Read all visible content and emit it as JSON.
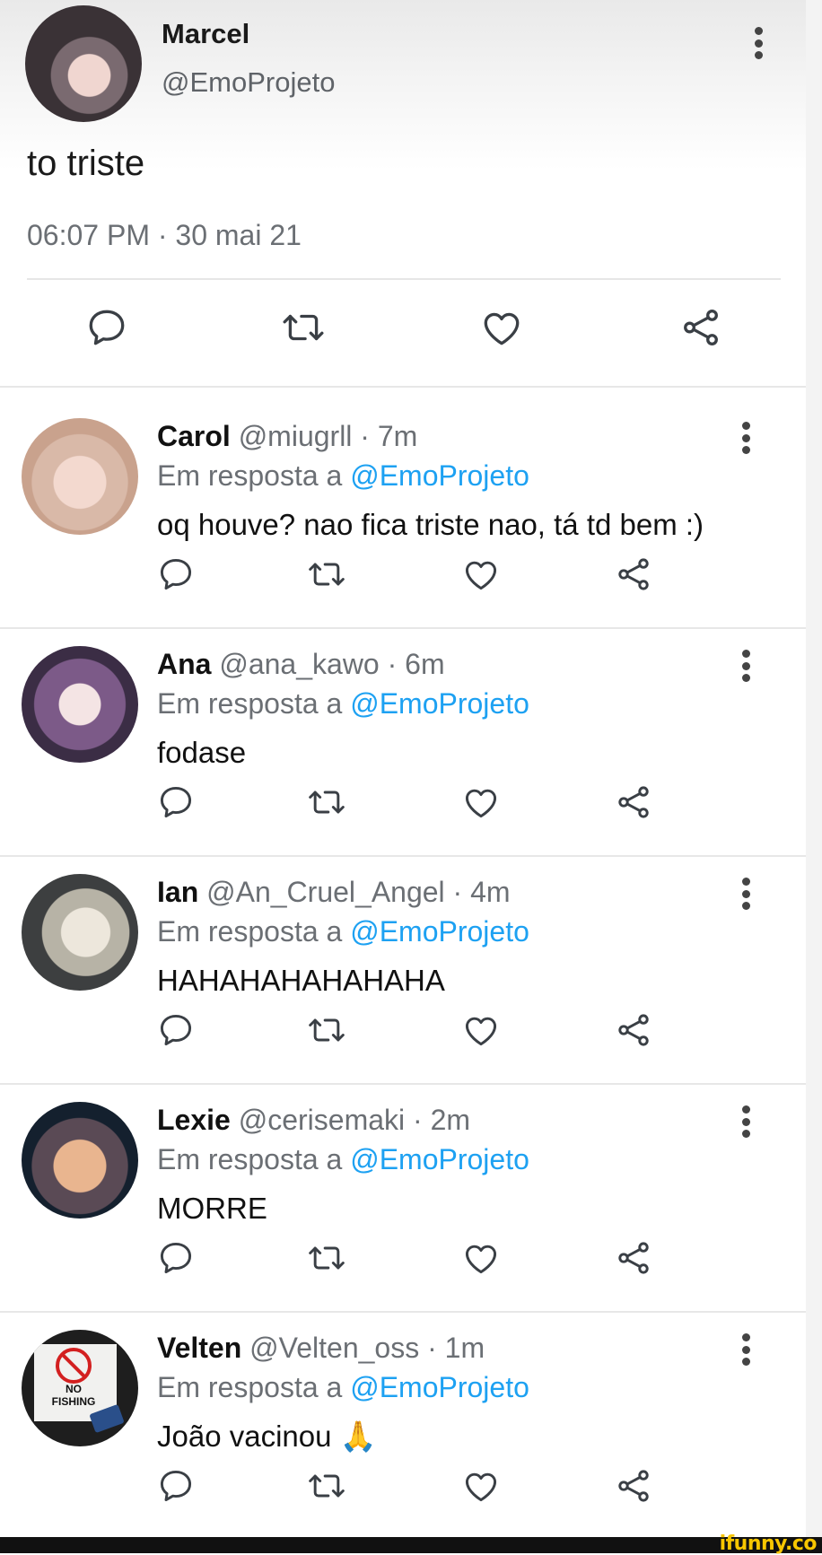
{
  "main_tweet": {
    "name": "Marcel",
    "handle": "@EmoProjeto",
    "text": "to triste",
    "timestamp": "06:07 PM · 30 mai 21"
  },
  "replies": [
    {
      "name": "Carol",
      "meta": "@miugrll · 7m",
      "reply_prefix": "Em resposta a",
      "reply_to": "@EmoProjeto",
      "text": "oq houve? nao fica triste nao, tá td bem :)"
    },
    {
      "name": "Ana",
      "meta": "@ana_kawo · 6m",
      "reply_prefix": "Em resposta a",
      "reply_to": "@EmoProjeto",
      "text": "fodase"
    },
    {
      "name": "Ian",
      "meta": "@An_Cruel_Angel · 4m",
      "reply_prefix": "Em resposta a",
      "reply_to": "@EmoProjeto",
      "text": "HAHAHAHAHAHAHA"
    },
    {
      "name": "Lexie",
      "meta": "@cerisemaki · 2m",
      "reply_prefix": "Em resposta a",
      "reply_to": "@EmoProjeto",
      "text": "MORRE"
    },
    {
      "name": "Velten",
      "meta": "@Velten_oss · 1m",
      "reply_prefix": "Em resposta a",
      "reply_to": "@EmoProjeto",
      "text": "João vacinou 🙏"
    }
  ],
  "icons": [
    "reply-icon",
    "retweet-icon",
    "like-icon",
    "share-icon",
    "more-options-icon"
  ],
  "colors": {
    "mention": "#1da1f2",
    "icon": "#3a3f45",
    "muted_text": "#6b6f74"
  },
  "watermark": "ifunny.co"
}
